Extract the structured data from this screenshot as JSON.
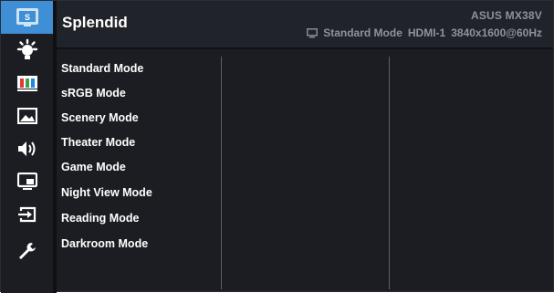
{
  "header": {
    "title": "Splendid",
    "model": "ASUS  MX38V",
    "status": {
      "mode": "Standard Mode",
      "input": "HDMI-1",
      "resolution": "3840x1600@60Hz",
      "icon": "monitor-icon"
    }
  },
  "sidebar": {
    "items": [
      {
        "icon": "splendid-icon",
        "active": true
      },
      {
        "icon": "brightness-icon",
        "active": false
      },
      {
        "icon": "color-icon",
        "active": false
      },
      {
        "icon": "image-icon",
        "active": false
      },
      {
        "icon": "sound-icon",
        "active": false
      },
      {
        "icon": "pip-icon",
        "active": false
      },
      {
        "icon": "input-select-icon",
        "active": false
      },
      {
        "icon": "system-setup-icon",
        "active": false
      }
    ]
  },
  "modes": [
    "Standard Mode",
    "sRGB Mode",
    "Scenery Mode",
    "Theater Mode",
    "Game Mode",
    "Night View Mode",
    "Reading Mode",
    "Darkroom Mode"
  ],
  "colors": {
    "accent": "#3e8fd6",
    "panel": "#1b1d22",
    "text": "#ffffff",
    "muted": "#8e939b"
  }
}
